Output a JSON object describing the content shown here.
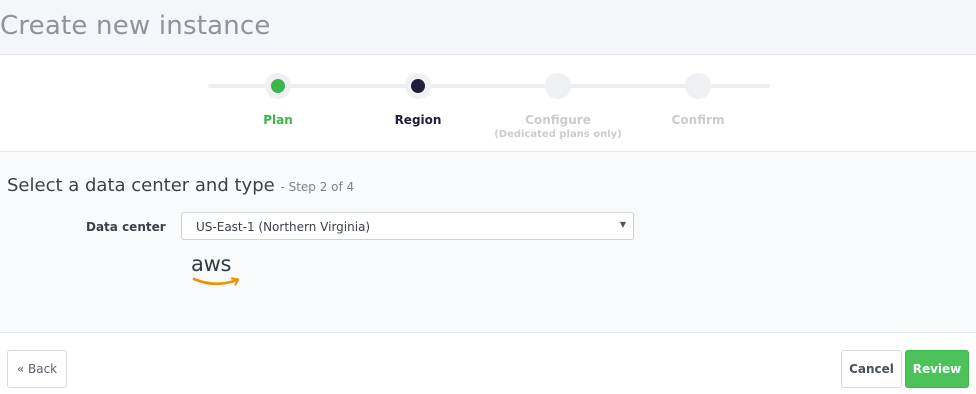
{
  "header": {
    "title": "Create new instance"
  },
  "stepper": {
    "steps": [
      {
        "label": "Plan",
        "sublabel": "",
        "state": "completed"
      },
      {
        "label": "Region",
        "sublabel": "",
        "state": "active"
      },
      {
        "label": "Configure",
        "sublabel": "(Dedicated plans only)",
        "state": "pending"
      },
      {
        "label": "Confirm",
        "sublabel": "",
        "state": "pending"
      }
    ]
  },
  "section": {
    "title": "Select a data center and type",
    "step_text": "- Step 2 of 4"
  },
  "data_center": {
    "label": "Data center",
    "selected": "US-East-1 (Northern Virginia)",
    "provider_logo": "aws",
    "provider_logo_icon": "aws-logo"
  },
  "buttons": {
    "back": "« Back",
    "cancel": "Cancel",
    "review": "Review"
  },
  "colors": {
    "completed": "#3cb54a",
    "active": "#1f1e3d",
    "pending": "#c9cdd2",
    "primary_button": "#4cc35a",
    "aws_orange": "#f29100"
  }
}
